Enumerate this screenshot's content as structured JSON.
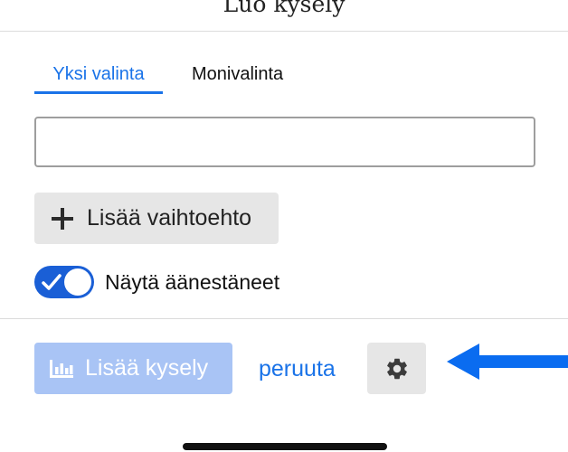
{
  "dialog": {
    "title": "Luo kysely"
  },
  "tabs": [
    {
      "label": "Yksi valinta",
      "active": true
    },
    {
      "label": "Monivalinta",
      "active": false
    }
  ],
  "option_input": {
    "value": "",
    "placeholder": ""
  },
  "add_option": {
    "label": "Lisää vaihtoehto",
    "icon": "plus-icon"
  },
  "show_voters": {
    "label": "Näytä äänestäneet",
    "enabled": true
  },
  "footer": {
    "add_poll_label": "Lisää kysely",
    "add_poll_icon": "bar-chart-icon",
    "cancel_label": "peruuta",
    "settings_icon": "gear-icon"
  },
  "colors": {
    "accent": "#1a73e8",
    "toggle_on": "#1a5fd6",
    "disabled_button": "#a9c4f5",
    "button_bg": "#e6e6e6",
    "annotation_arrow": "#0a6cf0"
  }
}
